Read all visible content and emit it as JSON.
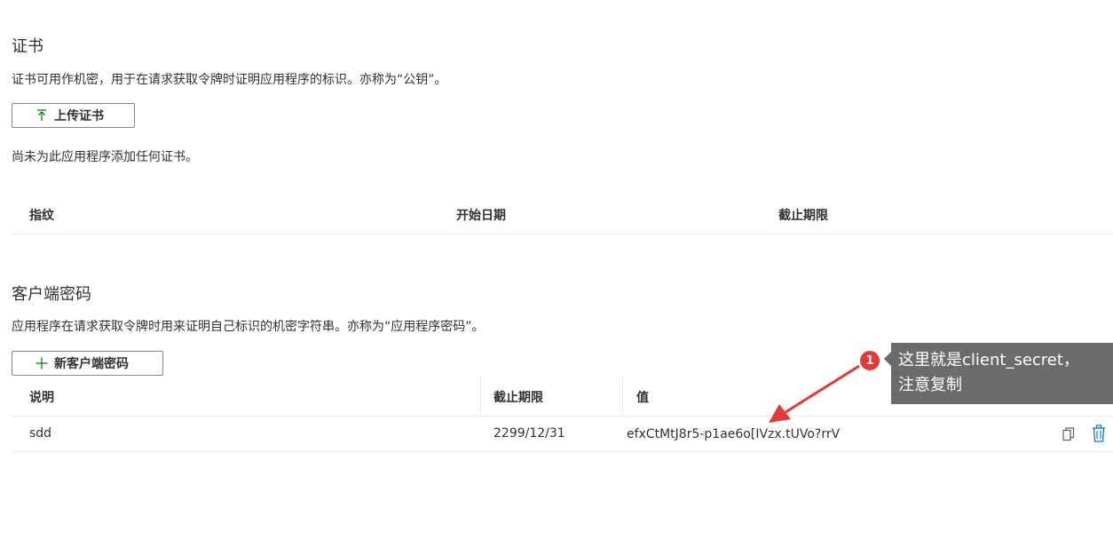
{
  "certificates": {
    "title": "证书",
    "description": "证书可用作机密，用于在请求获取令牌时证明应用程序的标识。亦称为“公钥”。",
    "upload_button": {
      "icon": "upload-arrow-icon",
      "label": "上传证书"
    },
    "empty_message": "尚未为此应用程序添加任何证书。",
    "table": {
      "columns": [
        "指纹",
        "开始日期",
        "截止期限"
      ]
    }
  },
  "client_secrets": {
    "title": "客户端密码",
    "description": "应用程序在请求获取令牌时用来证明自己标识的机密字符串。亦称为“应用程序密码”。",
    "new_button": {
      "icon": "plus-icon",
      "label": "新客户端密码"
    },
    "table": {
      "columns": [
        "说明",
        "截止期限",
        "值"
      ],
      "rows": [
        {
          "description": "sdd",
          "expires": "2299/12/31",
          "value": "efxCtMtJ8r5-p1ae6o[IVzx.tUVo?rrV"
        }
      ]
    }
  },
  "annotation": {
    "badge": "1",
    "line1": "这里就是client_secret，",
    "line2": "注意复制"
  },
  "colors": {
    "accent_green": "#107c10",
    "link_blue": "#0078d4",
    "callout_bg": "#6b6b6b",
    "badge_red": "#e53935",
    "arrow_red": "#e53935"
  }
}
